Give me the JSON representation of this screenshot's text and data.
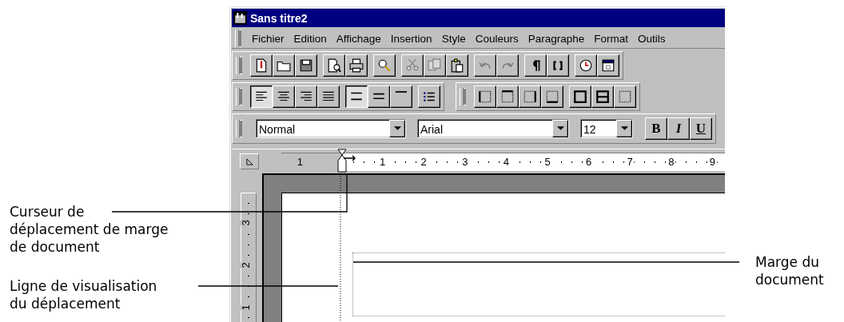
{
  "window": {
    "title": "Sans titre2"
  },
  "menu": [
    "Fichier",
    "Edition",
    "Affichage",
    "Insertion",
    "Style",
    "Couleurs",
    "Paragraphe",
    "Format",
    "Outils"
  ],
  "standard_toolbar": {
    "groups": [
      [
        {
          "kind": "new",
          "disabled": false
        },
        {
          "kind": "open",
          "disabled": false
        },
        {
          "kind": "save",
          "disabled": false
        }
      ],
      [
        {
          "kind": "preview",
          "disabled": false
        },
        {
          "kind": "print",
          "disabled": false
        }
      ],
      [
        {
          "kind": "find",
          "disabled": false
        }
      ],
      [
        {
          "kind": "cut",
          "disabled": true
        },
        {
          "kind": "copy",
          "disabled": true
        },
        {
          "kind": "paste",
          "disabled": false
        }
      ],
      [
        {
          "kind": "undo",
          "disabled": true
        },
        {
          "kind": "redo",
          "disabled": true
        }
      ],
      [
        {
          "kind": "pilcrow",
          "disabled": false
        },
        {
          "kind": "brackets",
          "disabled": false
        }
      ],
      [
        {
          "kind": "clock",
          "disabled": false
        },
        {
          "kind": "calendar",
          "disabled": false
        }
      ]
    ]
  },
  "paragraph_toolbar": {
    "groups": [
      [
        {
          "kind": "align_left",
          "selected": true
        },
        {
          "kind": "align_center",
          "selected": false
        },
        {
          "kind": "align_right",
          "selected": false
        },
        {
          "kind": "justify",
          "selected": false
        }
      ],
      [
        {
          "kind": "spacing_wide",
          "selected": true
        },
        {
          "kind": "spacing_medium",
          "selected": false
        },
        {
          "kind": "spacing_single",
          "selected": false
        }
      ],
      [
        {
          "kind": "bullets",
          "selected": false
        }
      ]
    ]
  },
  "borders_toolbar": {
    "groups": [
      [
        {
          "kind": "border_left",
          "selected": false
        },
        {
          "kind": "border_top",
          "selected": false
        },
        {
          "kind": "border_right",
          "selected": false
        },
        {
          "kind": "border_bottom",
          "selected": false
        }
      ],
      [
        {
          "kind": "border_box",
          "selected": false
        },
        {
          "kind": "border_middle",
          "selected": false
        },
        {
          "kind": "border_none",
          "selected": false
        }
      ]
    ]
  },
  "format_bar": {
    "style_field": {
      "value": "Normal"
    },
    "font_field": {
      "value": "Arial"
    },
    "size_field": {
      "value": "12"
    },
    "style_buttons": [
      {
        "kind": "bold",
        "label": "B"
      },
      {
        "kind": "italic",
        "label": "I"
      },
      {
        "kind": "underline",
        "label": "U"
      }
    ]
  },
  "horizontal_ruler": {
    "labels": [
      "1",
      "1",
      "2",
      "3",
      "4",
      "5",
      "6",
      "7",
      "8",
      "9"
    ]
  },
  "vertical_ruler": {
    "labels": [
      "3",
      "2",
      "1"
    ]
  },
  "left_callouts": [
    "Curseur de\ndéplacement de marge\nde document",
    "Ligne de visualisation\ndu déplacement"
  ],
  "right_callouts": [
    "Marge du\ndocument"
  ]
}
